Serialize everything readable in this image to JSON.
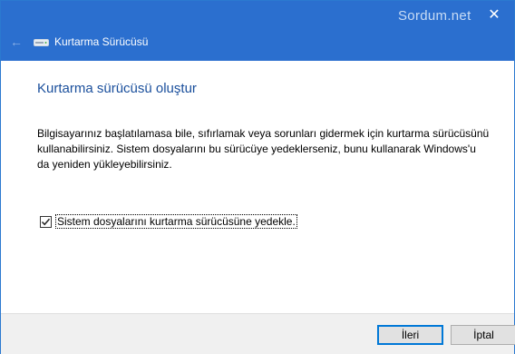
{
  "titlebar": {
    "watermark": "Sordum.net",
    "close_glyph": "✕",
    "back_glyph": "←",
    "title": "Kurtarma Sürücüsü",
    "icons": {
      "back": "back-arrow-icon",
      "drive": "drive-icon",
      "close": "close-icon"
    }
  },
  "content": {
    "heading": "Kurtarma sürücüsü oluştur",
    "description": "Bilgisayarınız başlatılamasa bile, sıfırlamak veya sorunları gidermek için kurtarma sürücüsünü kullanabilirsiniz. Sistem dosyalarını bu sürücüye yedeklerseniz, bunu kullanarak Windows'u da yeniden yükleyebilirsiniz.",
    "checkbox": {
      "label": "Sistem dosyalarını kurtarma sürücüsüne yedekle.",
      "checked": true
    }
  },
  "footer": {
    "next_label": "İleri",
    "cancel_label": "İptal"
  },
  "colors": {
    "titlebar": "#2b6fcf",
    "heading": "#1a4f9c",
    "accent": "#0078d7"
  }
}
